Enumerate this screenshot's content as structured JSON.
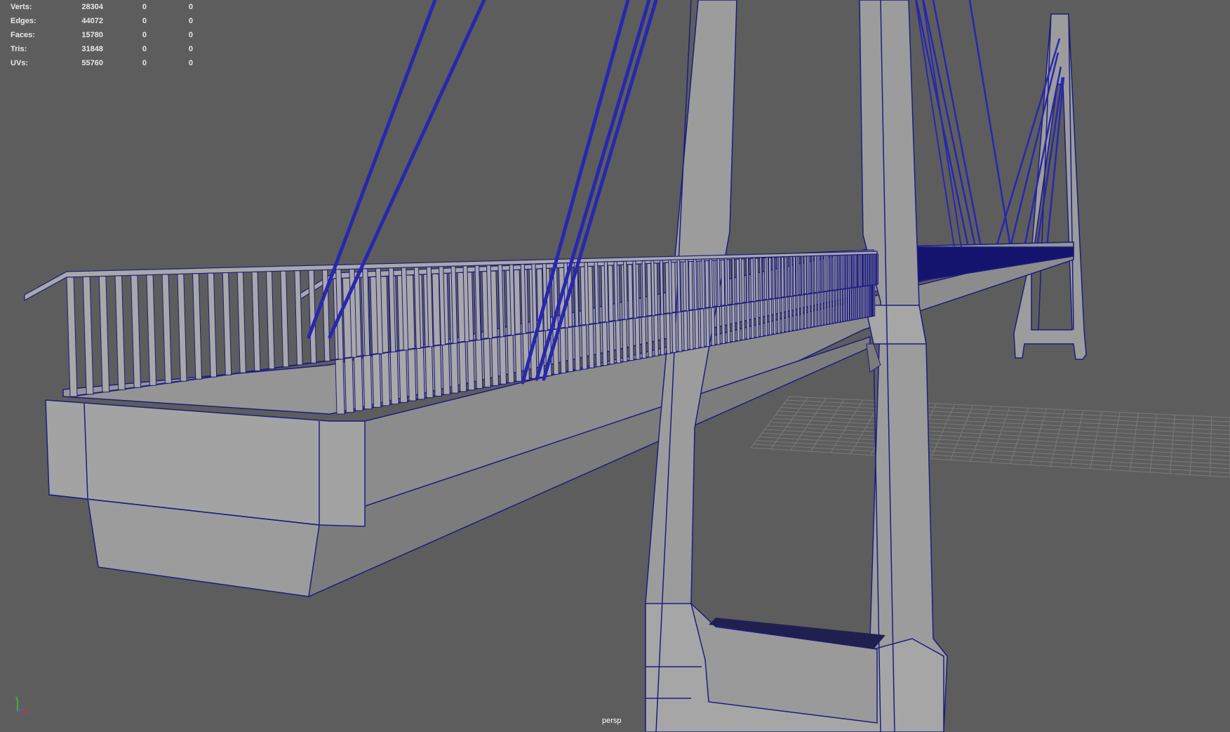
{
  "app": {
    "name": "3D modeling viewport"
  },
  "hud": {
    "rows": [
      {
        "label": "Verts:",
        "v1": "28304",
        "v2": "0",
        "v3": "0"
      },
      {
        "label": "Edges:",
        "v1": "44072",
        "v2": "0",
        "v3": "0"
      },
      {
        "label": "Faces:",
        "v1": "15780",
        "v2": "0",
        "v3": "0"
      },
      {
        "label": "Tris:",
        "v1": "31848",
        "v2": "0",
        "v3": "0"
      },
      {
        "label": "UVs:",
        "v1": "55760",
        "v2": "0",
        "v3": "0"
      }
    ]
  },
  "viewport": {
    "camera_label": "persp",
    "axis_labels": {
      "y": "y",
      "x": "x",
      "z": "z"
    },
    "scene_object": "cable-stayed-footbridge"
  },
  "colors": {
    "background": "#5d5d5d",
    "surface": "#9c9c9c",
    "surface_dark": "#8c8c8c",
    "wire": "#1c1c80",
    "wire_bright": "#2727b0",
    "grid": "#7a7a7a",
    "hud_text": "#e8e8e8"
  }
}
